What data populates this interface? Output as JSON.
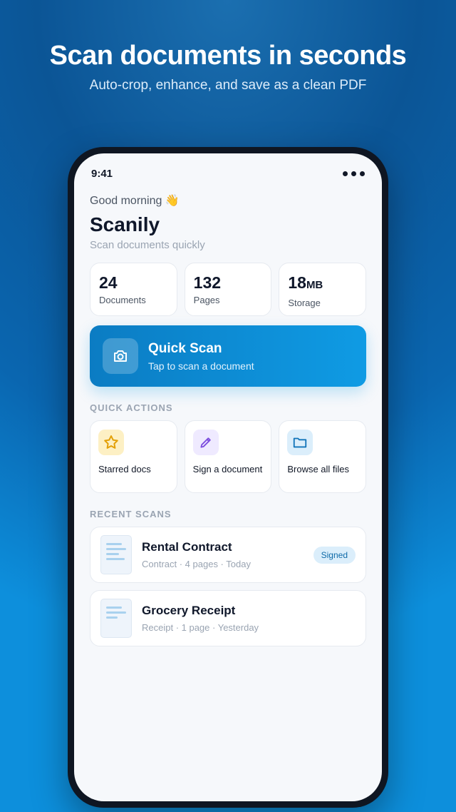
{
  "hero": {
    "title": "Scan documents in seconds",
    "subtitle": "Auto-crop, enhance, and save as a clean PDF"
  },
  "status_bar": {
    "time": "9:41"
  },
  "header": {
    "greeting": "Good morning 👋",
    "app_name": "Scanily",
    "tagline": "Scan documents quickly"
  },
  "stats": [
    {
      "value": "24",
      "unit": "",
      "label": "Documents"
    },
    {
      "value": "132",
      "unit": "",
      "label": "Pages"
    },
    {
      "value": "18",
      "unit": "MB",
      "label": "Storage"
    }
  ],
  "quick_scan": {
    "title": "Quick Scan",
    "subtitle": "Tap to scan a document",
    "icon": "camera-icon"
  },
  "quick_actions": {
    "section_label": "QUICK ACTIONS",
    "items": [
      {
        "label": "Starred docs",
        "icon": "star-icon",
        "color": "#e3a008"
      },
      {
        "label": "Sign a document",
        "icon": "pencil-icon",
        "color": "#7c4dde"
      },
      {
        "label": "Browse all files",
        "icon": "folder-icon",
        "color": "#1174b9"
      }
    ]
  },
  "recent_scans": {
    "section_label": "RECENT SCANS",
    "items": [
      {
        "title": "Rental Contract",
        "meta": "Contract · 4 pages · Today",
        "badge": "Signed"
      },
      {
        "title": "Grocery Receipt",
        "meta": "Receipt · 1 page · Yesterday",
        "badge": ""
      }
    ]
  },
  "colors": {
    "accent": "#0f9be4",
    "badge_bg": "#dbeefb",
    "badge_text": "#0e6aa8"
  }
}
